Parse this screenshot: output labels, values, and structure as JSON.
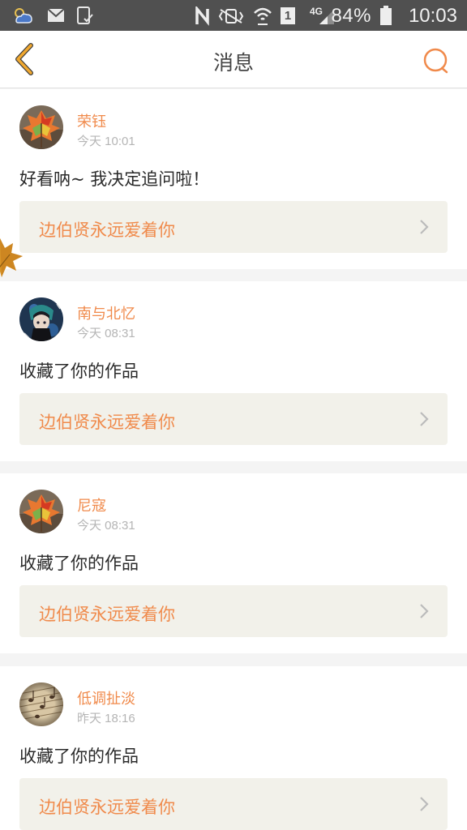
{
  "status_bar": {
    "battery_percent": "84%",
    "time": "10:03",
    "network": "4G",
    "sim_slot": "1"
  },
  "header": {
    "title": "消息",
    "back_icon": "chevron-left-icon",
    "search_icon": "search-icon"
  },
  "colors": {
    "accent": "#f08a4b",
    "back_icon": "#f0a830",
    "card_bg": "#ffffff",
    "work_box_bg": "#f2f1ea",
    "page_bg": "#f4f4f4"
  },
  "messages": [
    {
      "user": "荣钰",
      "time": "今天 10:01",
      "text": "好看呐~ 我决定追问啦！",
      "work": "边伯贤永远爱着你"
    },
    {
      "user": "南与北忆",
      "time": "今天 08:31",
      "text": "收藏了你的作品",
      "work": "边伯贤永远爱着你"
    },
    {
      "user": "尼寇",
      "time": "今天 08:31",
      "text": "收藏了你的作品",
      "work": "边伯贤永远爱着你"
    },
    {
      "user": "低调扯淡",
      "time": "昨天 18:16",
      "text": "收藏了你的作品",
      "work": "边伯贤永远爱着你"
    }
  ]
}
